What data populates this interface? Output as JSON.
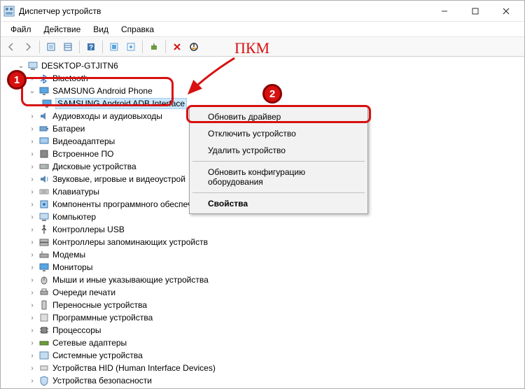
{
  "window": {
    "title": "Диспетчер устройств"
  },
  "menu": {
    "file": "Файл",
    "action": "Действие",
    "view": "Вид",
    "help": "Справка"
  },
  "tree": {
    "root": "DESKTOP-GTJITN6",
    "bluetooth": "Bluetooth",
    "samsung_phone": "SAMSUNG Android Phone",
    "samsung_adb": "SAMSUNG Android ADB Interface",
    "audio": "Аудиовходы и аудиовыходы",
    "battery": "Батареи",
    "video": "Видеоадаптеры",
    "firmware": "Встроенное ПО",
    "disks": "Дисковые устройства",
    "sound": "Звуковые, игровые и видеоустрой",
    "keyboards": "Клавиатуры",
    "swcomp": "Компоненты программного обеспечения",
    "computer": "Компьютер",
    "usb": "Контроллеры USB",
    "storage": "Контроллеры запоминающих устройств",
    "modems": "Модемы",
    "monitors": "Мониторы",
    "mice": "Мыши и иные указывающие устройства",
    "printqueue": "Очереди печати",
    "portable": "Переносные устройства",
    "other": "Программные устройства",
    "cpu": "Процессоры",
    "net": "Сетевые адаптеры",
    "system": "Системные устройства",
    "hid": "Устройства HID (Human Interface Devices)",
    "security": "Устройства безопасности"
  },
  "context_menu": {
    "update": "Обновить драйвер",
    "disable": "Отключить устройство",
    "remove": "Удалить устройство",
    "scan": "Обновить конфигурацию оборудования",
    "props": "Свойства"
  },
  "annotations": {
    "pkm": "ПКМ",
    "badge1": "1",
    "badge2": "2"
  }
}
